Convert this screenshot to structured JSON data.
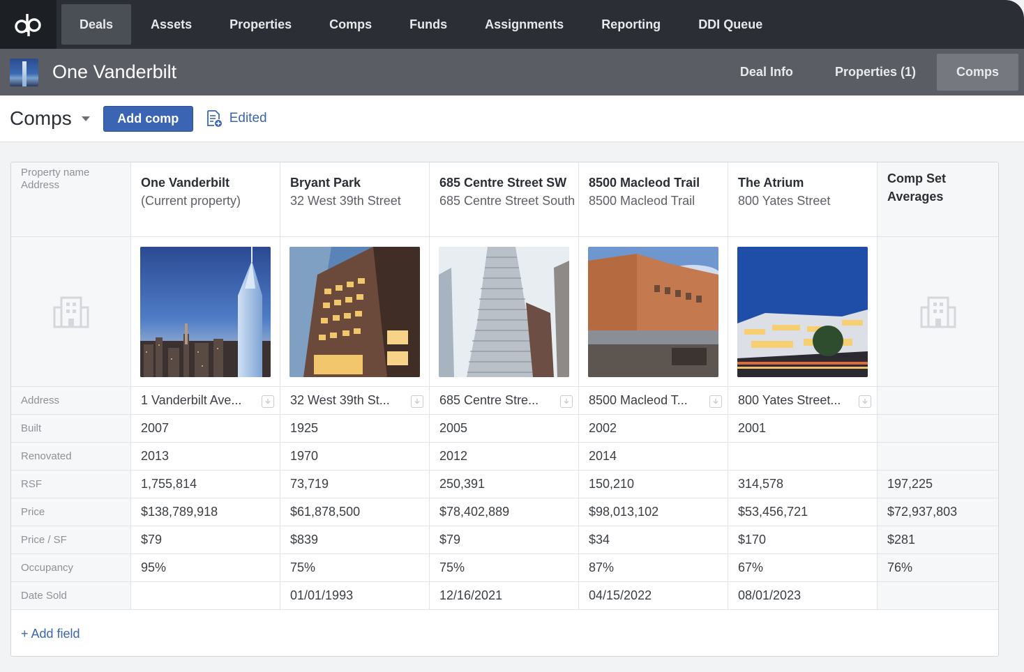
{
  "nav": {
    "items": [
      "Deals",
      "Assets",
      "Properties",
      "Comps",
      "Funds",
      "Assignments",
      "Reporting",
      "DDI Queue"
    ],
    "active": "Deals"
  },
  "deal": {
    "title": "One Vanderbilt",
    "tabs": [
      "Deal Info",
      "Properties (1)",
      "Comps"
    ]
  },
  "toolbar": {
    "title": "Comps",
    "add_label": "Add comp",
    "edited_label": "Edited"
  },
  "table": {
    "header_label_line1": "Property name",
    "header_label_line2": "Address",
    "columns": [
      {
        "name": "One Vanderbilt",
        "sub": "(Current property)"
      },
      {
        "name": "Bryant Park",
        "sub": "32 West 39th Street"
      },
      {
        "name": "685 Centre Street SW",
        "sub": "685 Centre Street South"
      },
      {
        "name": "8500 Macleod Trail",
        "sub": "8500 Macleod Trail"
      },
      {
        "name": "The Atrium",
        "sub": "800 Yates Street"
      }
    ],
    "averages_label": "Comp Set Averages",
    "rows": [
      {
        "label": "Address",
        "values": [
          "1 Vanderbilt Ave...",
          "32 West 39th St...",
          "685 Centre Stre...",
          "8500 Macleod T...",
          "800 Yates Street..."
        ],
        "avg": ""
      },
      {
        "label": "Built",
        "values": [
          "2007",
          "1925",
          "2005",
          "2002",
          "2001"
        ],
        "avg": ""
      },
      {
        "label": "Renovated",
        "values": [
          "2013",
          "1970",
          "2012",
          "2014",
          ""
        ],
        "avg": ""
      },
      {
        "label": "RSF",
        "values": [
          "1,755,814",
          "73,719",
          "250,391",
          "150,210",
          "314,578"
        ],
        "avg": "197,225"
      },
      {
        "label": "Price",
        "values": [
          "$138,789,918",
          "$61,878,500",
          "$78,402,889",
          "$98,013,102",
          "$53,456,721"
        ],
        "avg": "$72,937,803"
      },
      {
        "label": "Price / SF",
        "values": [
          "$79",
          "$839",
          "$79",
          "$34",
          "$170"
        ],
        "avg": "$281"
      },
      {
        "label": "Occupancy",
        "values": [
          "95%",
          "75%",
          "75%",
          "87%",
          "67%"
        ],
        "avg": "76%"
      },
      {
        "label": "Date Sold",
        "values": [
          "",
          "01/01/1993",
          "12/16/2021",
          "04/15/2022",
          "08/01/2023"
        ],
        "avg": ""
      }
    ],
    "add_field_label": "+ Add field"
  },
  "colors": {
    "nav_bg": "#2b2f35",
    "deal_bar_bg": "#5a5e64",
    "accent": "#3b65b3"
  }
}
